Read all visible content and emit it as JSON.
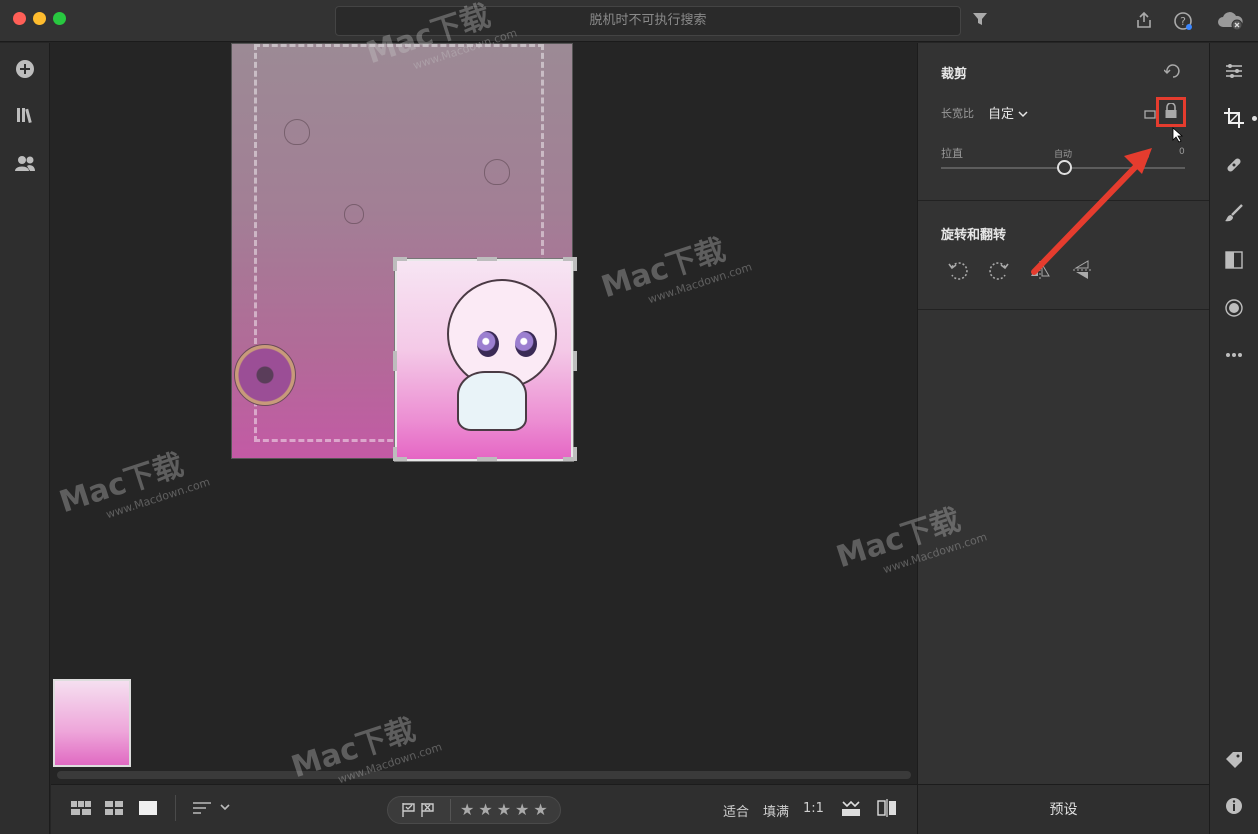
{
  "window": {
    "search_placeholder": "脱机时不可执行搜索"
  },
  "icons": {
    "filter": "filter-icon",
    "share": "share-icon",
    "help": "help-icon",
    "cloud": "cloud-icon",
    "add": "add-icon",
    "library": "library-icon",
    "people": "people-icon"
  },
  "crop_panel": {
    "title": "裁剪",
    "aspect_label": "长宽比",
    "aspect_value": "自定",
    "straighten_label": "拉直",
    "straighten_auto": "自动",
    "straighten_value": "0"
  },
  "rotate_panel": {
    "title": "旋转和翻转"
  },
  "bottom_bar": {
    "fit": "适合",
    "fill": "填满",
    "one_to_one": "1:1",
    "presets": "预设"
  },
  "rating": {
    "stars": "★★★★★"
  },
  "watermark": {
    "brand": "Mac下载",
    "url": "www.Macdown.com"
  },
  "colors": {
    "annotation": "#e53c2e",
    "panel_bg": "#333333",
    "canvas_bg": "#252525"
  }
}
